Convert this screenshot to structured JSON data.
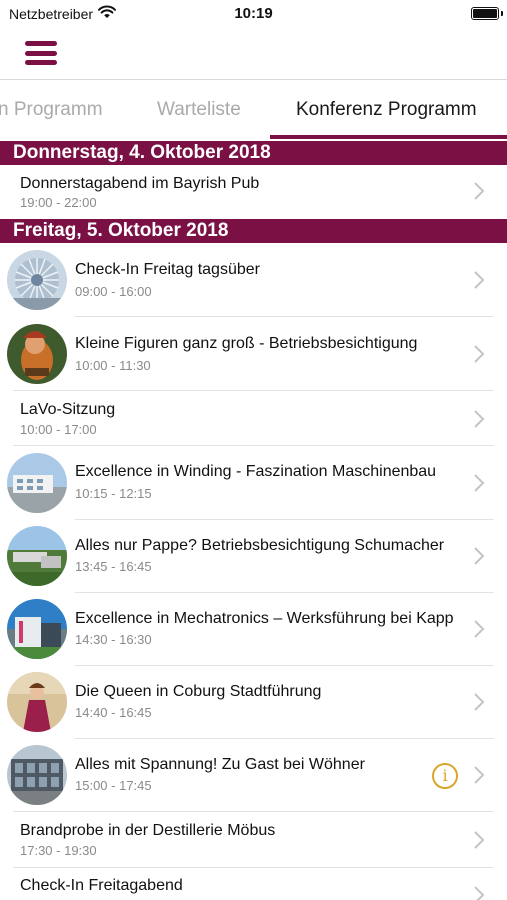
{
  "status_bar": {
    "carrier": "Netzbetreiber",
    "time": "10:19"
  },
  "tabs": [
    {
      "label": "n Programm"
    },
    {
      "label": "Warteliste"
    },
    {
      "label": "Konferenz Programm"
    }
  ],
  "sections": [
    {
      "header": "Donnerstag, 4. Oktober 2018",
      "items": [
        {
          "title": "Donnerstagabend im Bayrish Pub",
          "time": "19:00 - 22:00"
        }
      ]
    },
    {
      "header": "Freitag, 5. Oktober 2018",
      "items": [
        {
          "title": "Check-In Freitag tagsüber",
          "time": "09:00 - 16:00",
          "thumb": "glass-dome-photo"
        },
        {
          "title": "Kleine Figuren ganz groß - Betriebsbesichtigung",
          "time": "10:00 - 11:30",
          "thumb": "figurine-photo"
        },
        {
          "title": "LaVo-Sitzung",
          "time": "10:00 - 17:00"
        },
        {
          "title": "Excellence in Winding - Faszination Maschinenbau",
          "time": "10:15 - 12:15",
          "thumb": "factory-building-photo"
        },
        {
          "title": "Alles nur Pappe? Betriebsbesichtigung Schumacher",
          "time": "13:45 - 16:45",
          "thumb": "aerial-factory-photo"
        },
        {
          "title": "Excellence in Mechatronics – Werksführung bei Kapp",
          "time": "14:30 - 16:30",
          "thumb": "modern-building-photo"
        },
        {
          "title": "Die Queen in Coburg Stadtführung",
          "time": "14:40 - 16:45",
          "thumb": "queen-costume-photo"
        },
        {
          "title": "Alles mit Spannung! Zu Gast bei Wöhner",
          "time": "15:00 - 17:45",
          "thumb": "office-building-photo",
          "info": "i"
        },
        {
          "title": "Brandprobe in der Destillerie Möbus",
          "time": "17:30 - 19:30"
        },
        {
          "title": "Check-In Freitagabend",
          "time": ""
        }
      ]
    }
  ],
  "colors": {
    "accent": "#7b1045",
    "info": "#d9a62b",
    "subtitle": "#8a8a8a"
  }
}
